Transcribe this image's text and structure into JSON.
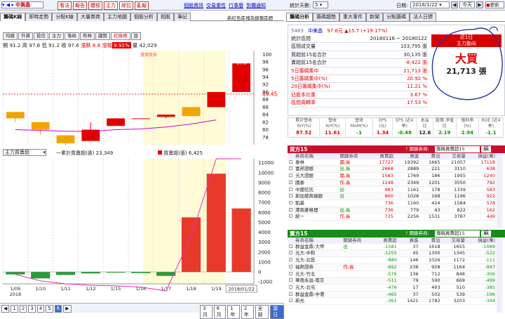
{
  "top_toolbar": {
    "stock": "中美晶",
    "links": [
      "看法",
      "報告",
      "體檢",
      "主力",
      "綜拉",
      "亂報"
    ],
    "right_links": [
      "個股資訊",
      "交易重性",
      "行事曆",
      "到價通知"
    ],
    "stats_days_label": "統計天數:",
    "stats_days_value": "5",
    "date_label": "日期:",
    "date_value": "2018/1/22",
    "today_btn": "今天",
    "refresh_btn": "更新"
  },
  "left_tabs": [
    "籌碼K線",
    "即時走勢",
    "分點K線",
    "大量券商",
    "主力地圖",
    "個股分析",
    "相股",
    "筆記"
  ],
  "left_notice": "新紅色區塊為鎖籌區間",
  "sub_tabs": [
    "均線",
    "外資",
    "投信",
    "主力",
    "籌碼",
    "布林",
    "趨勢",
    "紅綠燈",
    "設"
  ],
  "price_info": {
    "open": "開 91.2",
    "high": "高 97.6",
    "low": "低 91.2",
    "close": "收 97.6",
    "change": "漲跌 8.8",
    "pct_label": "漲幅",
    "pct": "9.91%",
    "vol_label": "量",
    "vol": "42,029"
  },
  "candle_chart": {
    "type": "candlestick",
    "categories": [
      "1/09",
      "1/10",
      "1/11",
      "1/12",
      "1/15",
      "1/16",
      "1/17",
      "1/18",
      "1/19",
      "1/22"
    ],
    "open": [
      84.7,
      82.0,
      78.5,
      77.0,
      81.0,
      83.0,
      83.4,
      86.0,
      86.0,
      90.0
    ],
    "close": [
      83.0,
      80.0,
      76.4,
      80.0,
      83.0,
      83.0,
      84.0,
      83.6,
      90.0,
      97.6
    ],
    "high": [
      84.7,
      82.0,
      78.5,
      82.0,
      83.0,
      83.0,
      84.0,
      86.0,
      90.0,
      97.6
    ],
    "low": [
      82.0,
      78.6,
      75.8,
      77.0,
      81.0,
      83.0,
      83.0,
      83.6,
      86.0,
      90.0
    ],
    "ma": [
      80.0,
      79.8,
      79.6,
      79.5,
      80.0,
      80.2,
      80.7,
      81.5,
      82.6,
      null
    ],
    "y_ticks": [
      "100",
      "98",
      "96",
      "94",
      "92",
      "90",
      "88",
      "86",
      "84",
      "82",
      "80",
      "78"
    ],
    "y_marker": "89.45",
    "annotations": [
      "97.6",
      "76.3",
      "量價背本"
    ],
    "ylim": [
      76,
      101
    ]
  },
  "volume_chart": {
    "type": "bar",
    "selector": "主力買賣超",
    "legend_line": "一累計買賣超(張) 23,349",
    "legend_bar": "買賣超(張) 6,425",
    "categories": [
      "1/09",
      "1/10",
      "1/11",
      "1/12",
      "1/15",
      "1/16",
      "1/17",
      "1/18",
      "1/19",
      "1/22"
    ],
    "values": [
      -250,
      -650,
      -300,
      -150,
      -50,
      -120,
      -400,
      5500,
      9900,
      6400
    ],
    "cumulative": [
      -250,
      -900,
      -1200,
      -1350,
      -1400,
      -1520,
      -1920,
      3580,
      13480,
      19880
    ],
    "y_ticks": [
      "11000",
      "10000",
      "9000",
      "8000",
      "7000",
      "6000",
      "5000",
      "4000",
      "3000",
      "2000",
      "1000",
      "0",
      "-1000"
    ],
    "ylim": [
      -1200,
      11400
    ],
    "x_year": "2018",
    "date_box": "2018/01/22"
  },
  "bottom_bar": {
    "pages": [
      "1",
      "2",
      "3",
      "4",
      "5",
      "6"
    ],
    "ranges": [
      "3月",
      "6月",
      "1年",
      "2年",
      "全部"
    ],
    "sel_range": "當日"
  },
  "right_tabs": [
    "籌碼分析",
    "籌碼趨勢",
    "重大事件",
    "新聞",
    "分點籌碼",
    "法人日標"
  ],
  "summary": {
    "code": "5483",
    "name": "中美晶",
    "price": "97.6元",
    "change": "▲15.7 (+19.17%)",
    "rows": [
      {
        "label": "統計區間",
        "value": "20180116 ~ 20180122"
      },
      {
        "label": "區間成交量",
        "value": "103,795 張"
      },
      {
        "label": "買超前15名合計",
        "value": "30,135 張"
      },
      {
        "label": "賣超前15名合計",
        "value": "-8,422 張"
      },
      {
        "label": "5日籌碼集中",
        "value": "21,713 張"
      },
      {
        "label": "5日籌碼集中(%)",
        "value": "20.92 %"
      },
      {
        "label": "20日籌碼集中(%)",
        "value": "11.21 %"
      },
      {
        "label": "佔股本比重",
        "value": "3.67 %"
      },
      {
        "label": "區間周轉率",
        "value": "17.53 %"
      }
    ],
    "signal_title": "近1日",
    "signal_sub": "主力動向",
    "signal": "大買",
    "signal_value": "21,713 張"
  },
  "metrics": {
    "headers": [
      "累計營收 YoY(%)",
      "營收 YoY(%)",
      "營收 MoM(%)",
      "EPS (元)",
      "EPS (近4季)",
      "本益比",
      "股價 淨值比",
      "殖利率 (%)",
      "ROE (近4季)"
    ],
    "values": [
      "87.52",
      "11.61",
      "-1",
      "1.34",
      "-0.48",
      "12.6",
      "2.19",
      "2.94",
      "-1.1"
    ]
  },
  "buy_table": {
    "title": "買方15",
    "filter_label": "關鍵券商:",
    "filter_value": "籌碼買賣超15",
    "edit_btn": "編",
    "headers": [
      "券商名稱",
      "關鍵券商",
      "買賣超",
      "買進",
      "賣出",
      "交易量",
      "損益(萬)"
    ],
    "rows": [
      [
        "泰林",
        "國,長",
        "17727",
        "19392",
        "1665",
        "21057",
        "17118"
      ],
      [
        "富邦證經",
        "出,長",
        "2668",
        "2889",
        "221",
        "3110",
        "638"
      ],
      [
        "元大證經",
        "國,長",
        "1583",
        "1769",
        "186",
        "1955",
        "1240"
      ],
      [
        "國泰",
        "作,長",
        "1148",
        "2349",
        "1201",
        "3550",
        "792"
      ],
      [
        "中國信託",
        "出",
        "983",
        "1161",
        "178",
        "1339",
        "583"
      ],
      [
        "新加坡商瑞銀",
        "出",
        "860",
        "1028",
        "168",
        "1196",
        "922"
      ],
      [
        "凱基",
        "",
        "736",
        "1160",
        "424",
        "1584",
        "578"
      ],
      [
        "港商麥格理",
        "出,長",
        "736",
        "779",
        "43",
        "822",
        "162"
      ],
      [
        "統一",
        "作,長",
        "725",
        "2256",
        "1531",
        "3787",
        "449"
      ]
    ]
  },
  "sell_table": {
    "title": "賣方15",
    "filter_label": "關鍵券商:",
    "filter_value": "籌碼買賣超15",
    "edit_btn": "編",
    "headers": [
      "券商名稱",
      "關鍵券商",
      "買賣超",
      "買進",
      "賣出",
      "交易量",
      "損益(萬)"
    ],
    "rows": [
      [
        "群益金鼎-大甲",
        "出",
        "-1581",
        "37",
        "1618",
        "1655",
        "-1089"
      ],
      [
        "元大-中和",
        "",
        "-1255",
        "45",
        "1300",
        "1345",
        "-522"
      ],
      [
        "元大-北投",
        "",
        "-880",
        "146",
        "1026",
        "1172",
        "-111"
      ],
      [
        "福邦證券",
        "作,長",
        "-692",
        "236",
        "928",
        "1164",
        "-997"
      ],
      [
        "元大-竹北",
        "",
        "-576",
        "136",
        "712",
        "848",
        "-306"
      ],
      [
        "華南永昌-南京",
        "",
        "-511",
        "79",
        "590",
        "669",
        "-499"
      ],
      [
        "元大-北屯",
        "",
        "-476",
        "17",
        "493",
        "510",
        "-385"
      ],
      [
        "群益金鼎-中港",
        "",
        "-465",
        "37",
        "502",
        "539",
        "-196"
      ],
      [
        "新光",
        "",
        "-361",
        "1421",
        "1782",
        "3203",
        "-344"
      ]
    ]
  }
}
